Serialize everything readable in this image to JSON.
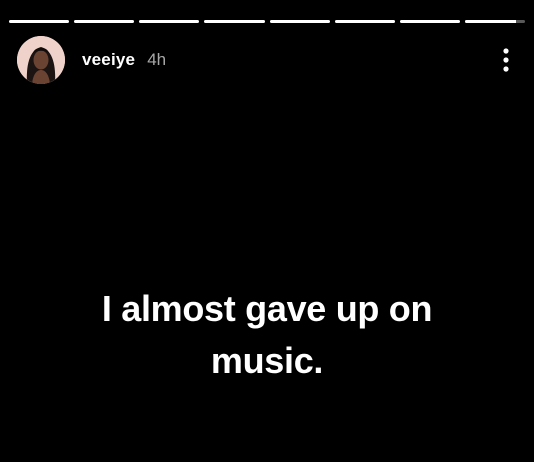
{
  "story": {
    "segment_count": 8,
    "segments_progress": [
      1,
      1,
      1,
      1,
      1,
      1,
      1,
      0.85
    ]
  },
  "header": {
    "username": "veeiye",
    "timestamp": "4h",
    "avatar_icon": "profile-photo",
    "menu_icon": "more-vertical-icon"
  },
  "content": {
    "text": "I almost gave up on music."
  },
  "colors": {
    "background": "#000000",
    "text": "#ffffff",
    "muted": "#a8a8a8"
  }
}
